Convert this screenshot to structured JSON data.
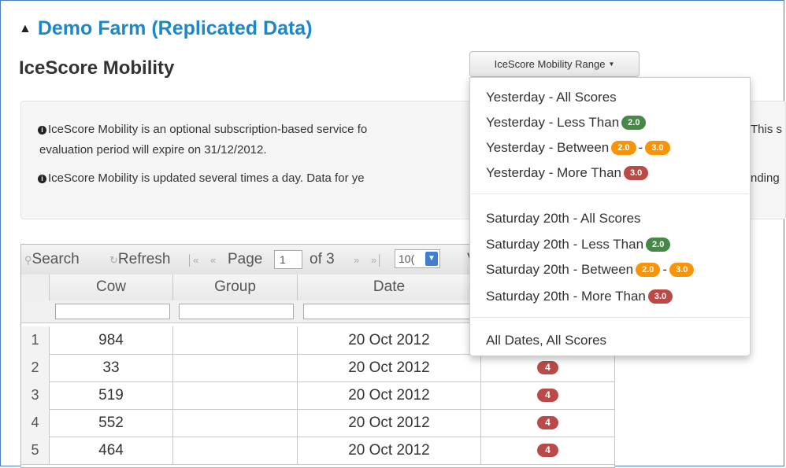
{
  "header": {
    "farm_title": "Demo Farm (Replicated Data)",
    "page_title": "IceScore Mobility"
  },
  "range_button": {
    "label": "IceScore Mobility Range"
  },
  "info": {
    "line1a": "IceScore Mobility is an optional subscription-based service fo",
    "line1b": "This s",
    "line2": "evaluation period will expire on 31/12/2012.",
    "line3a": "IceScore Mobility is updated several times a day. Data for ye",
    "line3b": "nding"
  },
  "toolbar": {
    "search": "Search",
    "refresh": "Refresh",
    "page_label": "Page",
    "page_value": "1",
    "of_label": "of 3",
    "rows_value": "10(",
    "extra": "V"
  },
  "columns": [
    "Cow",
    "Group",
    "Date"
  ],
  "rows": [
    {
      "num": "1",
      "cow": "984",
      "group": "",
      "date": "20 Oct 2012",
      "score": ""
    },
    {
      "num": "2",
      "cow": "33",
      "group": "",
      "date": "20 Oct 2012",
      "score": "4"
    },
    {
      "num": "3",
      "cow": "519",
      "group": "",
      "date": "20 Oct 2012",
      "score": "4"
    },
    {
      "num": "4",
      "cow": "552",
      "group": "",
      "date": "20 Oct 2012",
      "score": "4"
    },
    {
      "num": "5",
      "cow": "464",
      "group": "",
      "date": "20 Oct 2012",
      "score": "4"
    }
  ],
  "dropdown": {
    "yesterday_all": "Yesterday - All Scores",
    "yesterday_less": "Yesterday - Less Than",
    "yesterday_between": "Yesterday - Between",
    "yesterday_more": "Yesterday - More Than",
    "saturday_all": "Saturday 20th - All Scores",
    "saturday_less": "Saturday 20th - Less Than",
    "saturday_between": "Saturday 20th - Between",
    "saturday_more": "Saturday 20th - More Than",
    "all_dates": "All Dates, All Scores",
    "low": "2.0",
    "high": "3.0",
    "dash": "-"
  },
  "colors": {
    "title_blue": "#1a88c9",
    "badge_green": "#468847",
    "badge_orange": "#f89406",
    "badge_red": "#b94a48"
  }
}
